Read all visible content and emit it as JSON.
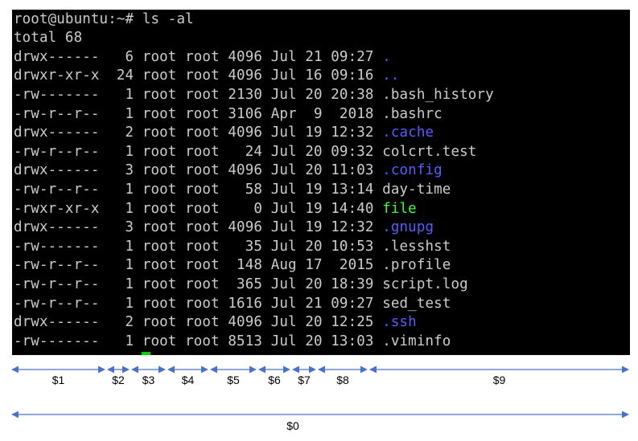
{
  "terminal": {
    "prompt": "root@ubuntu:~# ls -al",
    "total": "total 68",
    "colors": {
      "text": "#cccccc",
      "background": "#000000",
      "directory": "#5b5bff",
      "executable": "#3cff3c",
      "cursor": "#00d000"
    },
    "rows": [
      {
        "perms": "drwx------",
        "links": "6",
        "owner": "root",
        "group": "root",
        "size": "4096",
        "month": "Jul",
        "day": "21",
        "time": "09:27",
        "name": ".",
        "type": "dir"
      },
      {
        "perms": "drwxr-xr-x",
        "links": "24",
        "owner": "root",
        "group": "root",
        "size": "4096",
        "month": "Jul",
        "day": "16",
        "time": "09:16",
        "name": "..",
        "type": "dir"
      },
      {
        "perms": "-rw-------",
        "links": "1",
        "owner": "root",
        "group": "root",
        "size": "2130",
        "month": "Jul",
        "day": "20",
        "time": "20:38",
        "name": ".bash_history",
        "type": "file"
      },
      {
        "perms": "-rw-r--r--",
        "links": "1",
        "owner": "root",
        "group": "root",
        "size": "3106",
        "month": "Apr",
        "day": "9",
        "time": "2018",
        "name": ".bashrc",
        "type": "file"
      },
      {
        "perms": "drwx------",
        "links": "2",
        "owner": "root",
        "group": "root",
        "size": "4096",
        "month": "Jul",
        "day": "19",
        "time": "12:32",
        "name": ".cache",
        "type": "dir"
      },
      {
        "perms": "-rw-r--r--",
        "links": "1",
        "owner": "root",
        "group": "root",
        "size": "24",
        "month": "Jul",
        "day": "20",
        "time": "09:32",
        "name": "colcrt.test",
        "type": "file"
      },
      {
        "perms": "drwx------",
        "links": "3",
        "owner": "root",
        "group": "root",
        "size": "4096",
        "month": "Jul",
        "day": "20",
        "time": "11:03",
        "name": ".config",
        "type": "dir"
      },
      {
        "perms": "-rw-r--r--",
        "links": "1",
        "owner": "root",
        "group": "root",
        "size": "58",
        "month": "Jul",
        "day": "19",
        "time": "13:14",
        "name": "day-time",
        "type": "file"
      },
      {
        "perms": "-rwxr-xr-x",
        "links": "1",
        "owner": "root",
        "group": "root",
        "size": "0",
        "month": "Jul",
        "day": "19",
        "time": "14:40",
        "name": "file",
        "type": "exec"
      },
      {
        "perms": "drwx------",
        "links": "3",
        "owner": "root",
        "group": "root",
        "size": "4096",
        "month": "Jul",
        "day": "19",
        "time": "12:32",
        "name": ".gnupg",
        "type": "dir"
      },
      {
        "perms": "-rw-------",
        "links": "1",
        "owner": "root",
        "group": "root",
        "size": "35",
        "month": "Jul",
        "day": "20",
        "time": "10:53",
        "name": ".lesshst",
        "type": "file"
      },
      {
        "perms": "-rw-r--r--",
        "links": "1",
        "owner": "root",
        "group": "root",
        "size": "148",
        "month": "Aug",
        "day": "17",
        "time": "2015",
        "name": ".profile",
        "type": "file"
      },
      {
        "perms": "-rw-r--r--",
        "links": "1",
        "owner": "root",
        "group": "root",
        "size": "365",
        "month": "Jul",
        "day": "20",
        "time": "18:39",
        "name": "script.log",
        "type": "file"
      },
      {
        "perms": "-rw-r--r--",
        "links": "1",
        "owner": "root",
        "group": "root",
        "size": "1616",
        "month": "Jul",
        "day": "21",
        "time": "09:27",
        "name": "sed_test",
        "type": "file"
      },
      {
        "perms": "drwx------",
        "links": "2",
        "owner": "root",
        "group": "root",
        "size": "4096",
        "month": "Jul",
        "day": "20",
        "time": "12:25",
        "name": ".ssh",
        "type": "dir"
      },
      {
        "perms": "-rw-------",
        "links": "1",
        "owner": "root",
        "group": "root",
        "size": "8513",
        "month": "Jul",
        "day": "20",
        "time": "13:03",
        "name": ".viminfo",
        "type": "file"
      }
    ]
  },
  "annotations": {
    "line_color": "#4a72c4",
    "fields": [
      "$1",
      "$2",
      "$3",
      "$4",
      "$5",
      "$6",
      "$7",
      "$8",
      "$9"
    ],
    "whole": "$0"
  }
}
